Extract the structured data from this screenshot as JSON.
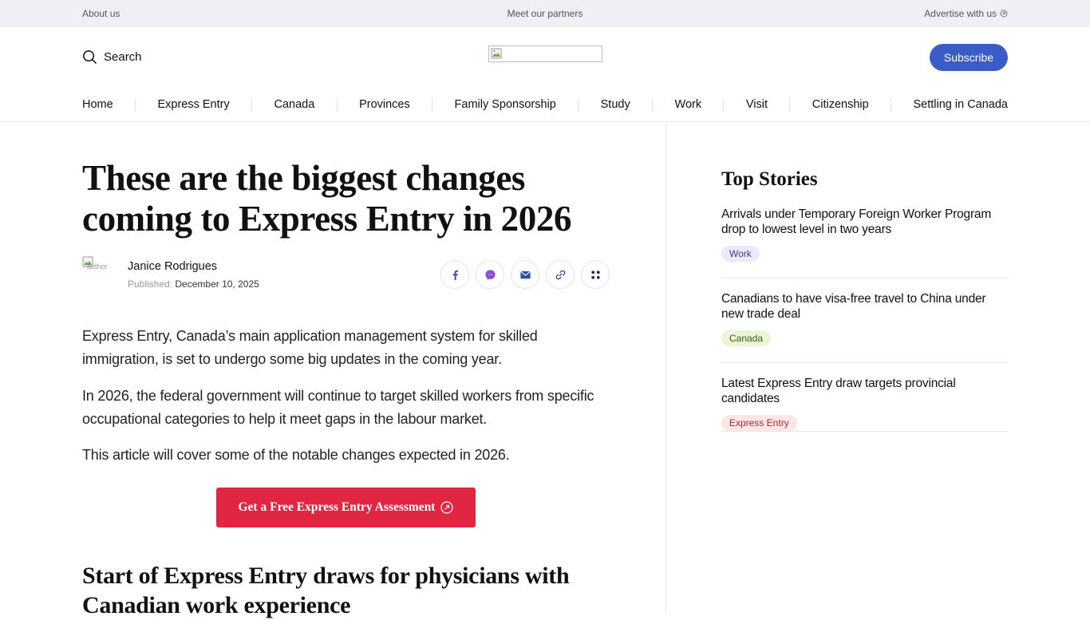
{
  "topbar": {
    "about": "About us",
    "partners": "Meet our partners",
    "advertise": "Advertise with us"
  },
  "header": {
    "search_label": "Search",
    "subscribe_label": "Subscribe"
  },
  "nav": {
    "items": [
      "Home",
      "Express Entry",
      "Canada",
      "Provinces",
      "Family Sponsorship",
      "Study",
      "Work",
      "Visit",
      "Citizenship",
      "Settling in Canada"
    ]
  },
  "article": {
    "headline": "These are the biggest changes coming to Express Entry in 2026",
    "avatar_alt": "author",
    "author": "Janice Rodrigues",
    "published_label": "Published:",
    "published_date": "December 10, 2025",
    "paragraphs": [
      "Express Entry, Canada’s main application management system for skilled immigration, is set to undergo some big updates in the coming year.",
      "In 2026, the federal government will continue to target skilled workers from specific occupational categories to help it meet gaps in the labour market.",
      "This article will cover some of the notable changes expected in 2026."
    ],
    "cta_label": "Get a Free Express Entry Assessment",
    "subheading": "Start of Express Entry draws for physicians with Canadian work experience"
  },
  "sidebar": {
    "heading": "Top Stories",
    "stories": [
      {
        "title": "Arrivals under Temporary Foreign Worker Program drop to lowest level in two years",
        "tag": "Work"
      },
      {
        "title": "Canadians to have visa-free travel to China under new trade deal",
        "tag": "Canada"
      },
      {
        "title": "Latest Express Entry draw targets provincial candidates",
        "tag": "Express Entry"
      }
    ]
  },
  "icons": {
    "search": "search-icon",
    "external": "external-link-icon",
    "facebook": "facebook-icon",
    "messenger": "messenger-icon",
    "email": "email-icon",
    "link": "link-icon",
    "more": "more-icon"
  },
  "colors": {
    "subscribe": "#3b5bc6",
    "cta": "#e02641",
    "facebook": "#3b5998",
    "messenger": "#8a4bd8"
  }
}
